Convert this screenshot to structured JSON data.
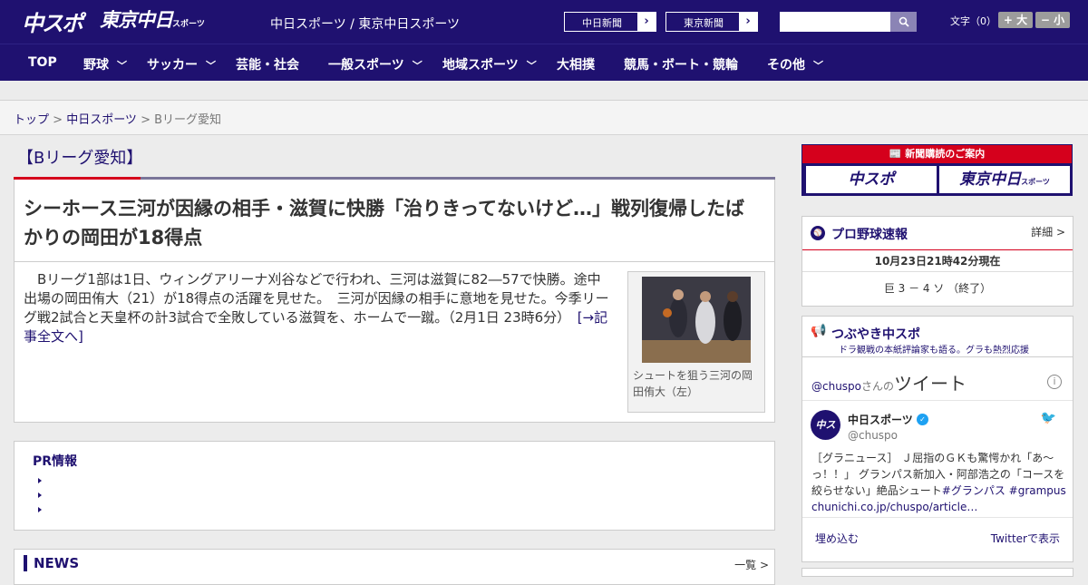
{
  "header": {
    "logo_chuspo": "中スポ",
    "logo_tokyo": "東京中日",
    "logo_tokyo_small": "スポーツ",
    "site_name": "中日スポーツ / 東京中日スポーツ",
    "btn_chunichi": "中日新聞",
    "btn_tokyo": "東京新聞",
    "search_placeholder": "",
    "font_size_label": "文字（0）",
    "font_bigger": "+ 大",
    "font_smaller": "− 小"
  },
  "nav": {
    "items": [
      {
        "label": "TOP",
        "dropdown": false
      },
      {
        "label": "野球",
        "dropdown": true
      },
      {
        "label": "サッカー",
        "dropdown": true
      },
      {
        "label": "芸能・社会",
        "dropdown": false
      },
      {
        "label": "一般スポーツ",
        "dropdown": true
      },
      {
        "label": "地域スポーツ",
        "dropdown": true
      },
      {
        "label": "大相撲",
        "dropdown": false
      },
      {
        "label": "競馬・ボート・競輪",
        "dropdown": false
      },
      {
        "label": "その他",
        "dropdown": true
      }
    ]
  },
  "breadcrumb": {
    "top": "トップ",
    "sep": " > ",
    "section": "中日スポーツ",
    "current": "Bリーグ愛知"
  },
  "article": {
    "category": "【Bリーグ愛知】",
    "headline": "シーホース三河が因縁の相手・滋賀に快勝「治りきってないけど…」戦列復帰したばかりの岡田が18得点",
    "body": "　Bリーグ1部は1日、ウィングアリーナ刈谷などで行われ、三河は滋賀に82―57で快勝。途中出場の岡田侑大（21）が18得点の活躍を見せた。　三河が因縁の相手に意地を見せた。今季リーグ戦2試合と天皇杯の計3試合で全敗している滋賀を、ホームで一蹴。（2月1日 23時6分）　",
    "more_link": "[→記事全文へ]",
    "photo_caption": "シュートを狙う三河の岡田侑大（左）"
  },
  "pr": {
    "title": "PR情報"
  },
  "news": {
    "title": "NEWS",
    "more": "一覧 >"
  },
  "sidebar": {
    "subscribe": {
      "banner": "📰 新聞購読のご案内",
      "logo_chuspo": "中スポ",
      "logo_tokyo": "東京中日",
      "logo_tokyo_small": "スポーツ"
    },
    "baseball": {
      "title": "プロ野球速報",
      "more": "詳細 >",
      "time": "10月23日21時42分現在",
      "score": "巨 3 － 4 ソ （終了）"
    },
    "twitter": {
      "title": "つぶやき中スポ",
      "subtitle": "ドラ観戦の本紙評論家も語る。グラも熱烈応援",
      "handle": "@chuspo",
      "handle_suffix": "さんの",
      "tweets_label": "ツイート",
      "account_name": "中日スポーツ",
      "account_user": "@chuspo",
      "tweet_text": "［グラニュース］ Ｊ屈指のＧＫも驚愕かれ「あ～っ！！」 グランパス新加入・阿部浩之の「コースを絞らせない」絶品シュート",
      "tweet_tag1": "#グランパス",
      "tweet_tag2": "#grampus",
      "tweet_link": "chunichi.co.jp/chuspo/article…",
      "embed": "埋め込む",
      "view_on": "Twitterで表示"
    }
  },
  "colors": {
    "brand_navy": "#1f1170",
    "accent_red": "#d5001c",
    "twitter_blue": "#1da1f2"
  }
}
